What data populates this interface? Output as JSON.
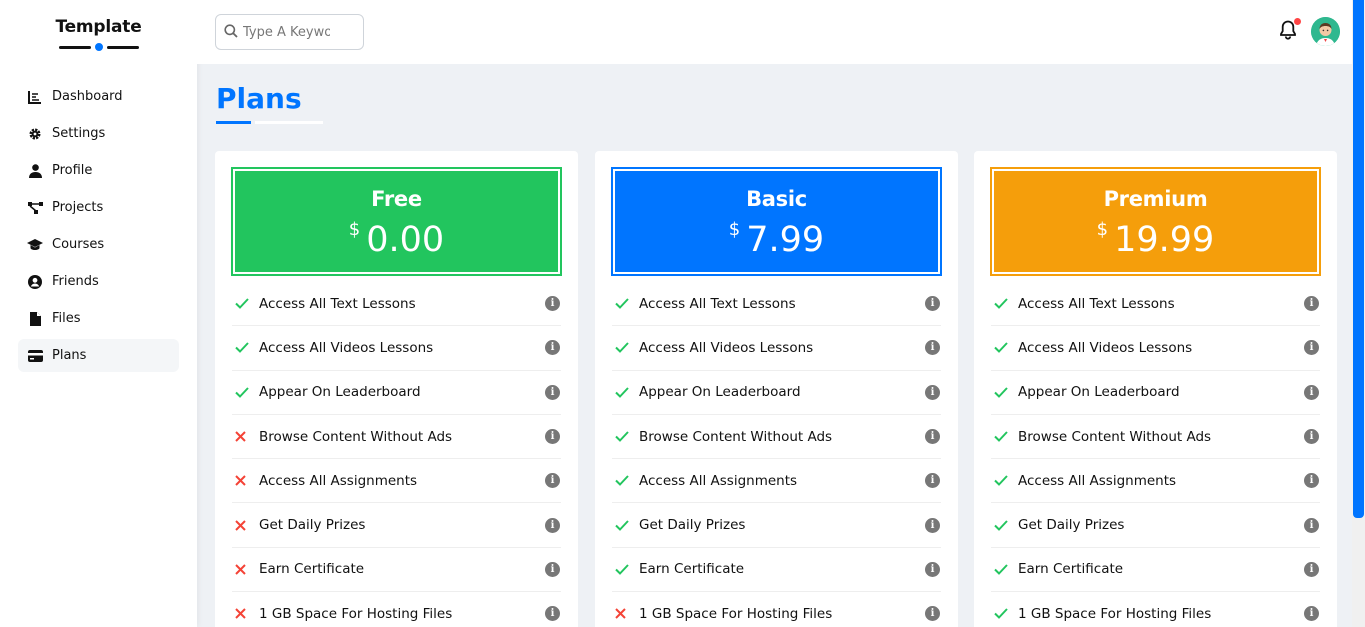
{
  "brand": {
    "title": "Template"
  },
  "sidebar": {
    "items": [
      {
        "label": "Dashboard",
        "icon": "chart-line-icon",
        "active": false
      },
      {
        "label": "Settings",
        "icon": "gear-icon",
        "active": false
      },
      {
        "label": "Profile",
        "icon": "user-icon",
        "active": false
      },
      {
        "label": "Projects",
        "icon": "diagram-project-icon",
        "active": false
      },
      {
        "label": "Courses",
        "icon": "graduation-cap-icon",
        "active": false
      },
      {
        "label": "Friends",
        "icon": "user-circle-icon",
        "active": false
      },
      {
        "label": "Files",
        "icon": "file-icon",
        "active": false
      },
      {
        "label": "Plans",
        "icon": "credit-card-icon",
        "active": true
      }
    ]
  },
  "search": {
    "placeholder": "Type A Keyword",
    "value": ""
  },
  "page": {
    "title": "Plans"
  },
  "colors": {
    "accent": "#0075ff",
    "free": "#22c55e",
    "basic": "#0075ff",
    "premium": "#f59e0b",
    "check": "#22c55e",
    "cross": "#f44336"
  },
  "features": [
    "Access All Text Lessons",
    "Access All Videos Lessons",
    "Appear On Leaderboard",
    "Browse Content Without Ads",
    "Access All Assignments",
    "Get Daily Prizes",
    "Earn Certificate",
    "1 GB Space For Hosting Files"
  ],
  "plans": [
    {
      "name": "Free",
      "currency": "$",
      "price": "0.00",
      "color": "#22c55e",
      "included": [
        true,
        true,
        true,
        false,
        false,
        false,
        false,
        false
      ]
    },
    {
      "name": "Basic",
      "currency": "$",
      "price": "7.99",
      "color": "#0075ff",
      "included": [
        true,
        true,
        true,
        true,
        true,
        true,
        true,
        false
      ]
    },
    {
      "name": "Premium",
      "currency": "$",
      "price": "19.99",
      "color": "#f59e0b",
      "included": [
        true,
        true,
        true,
        true,
        true,
        true,
        true,
        true
      ]
    }
  ]
}
